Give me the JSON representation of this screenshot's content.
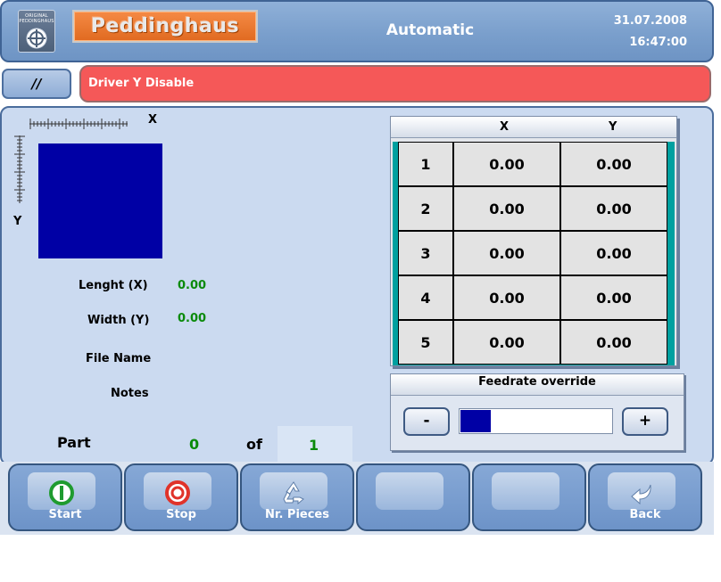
{
  "header": {
    "logo_text": "ORIGINAL PEDDINGHAUS",
    "brand": "Peddinghaus",
    "title": "Automatic",
    "date": "31.07.2008",
    "time": "16:47:00"
  },
  "status": {
    "mode_button": "//",
    "alarm": "Driver Y Disable",
    "alarm_color": "#f55858"
  },
  "preview": {
    "x_label": "X",
    "y_label": "Y",
    "shape_color": "#0000a5"
  },
  "part_info": {
    "length_label": "Lenght (X)",
    "length_value": "0.00",
    "width_label": "Width (Y)",
    "width_value": "0.00",
    "file_name_label": "File Name",
    "notes_label": "Notes",
    "part_label": "Part",
    "part_current": "0",
    "of_label": "of",
    "part_total": "1"
  },
  "coord_table": {
    "columns": [
      "X",
      "Y"
    ],
    "rows": [
      {
        "index": "1",
        "x": "0.00",
        "y": "0.00"
      },
      {
        "index": "2",
        "x": "0.00",
        "y": "0.00"
      },
      {
        "index": "3",
        "x": "0.00",
        "y": "0.00"
      },
      {
        "index": "4",
        "x": "0.00",
        "y": "0.00"
      },
      {
        "index": "5",
        "x": "0.00",
        "y": "0.00"
      }
    ]
  },
  "feedrate": {
    "title": "Feedrate override",
    "minus_label": "-",
    "plus_label": "+",
    "level": 0.2
  },
  "toolbar": {
    "buttons": [
      {
        "label": "Start",
        "icon": "start-icon"
      },
      {
        "label": "Stop",
        "icon": "stop-icon"
      },
      {
        "label": "Nr. Pieces",
        "icon": "recycle-icon"
      },
      {
        "label": "",
        "icon": ""
      },
      {
        "label": "",
        "icon": ""
      },
      {
        "label": "Back",
        "icon": "back-arrow-icon"
      }
    ]
  }
}
